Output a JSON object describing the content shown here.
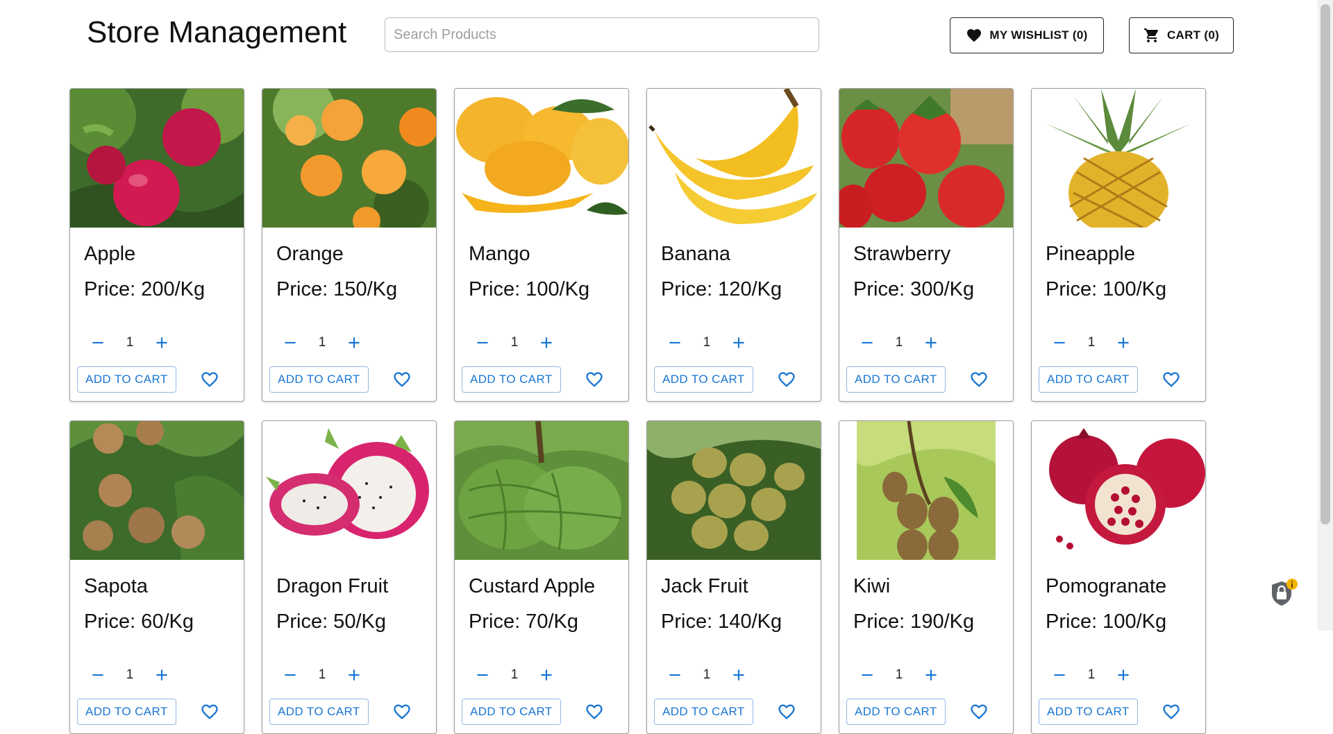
{
  "header": {
    "title": "Store Management",
    "search_placeholder": "Search Products",
    "wishlist_label": "MY WISHLIST (0)",
    "cart_label": "CART (0)"
  },
  "colors": {
    "accent": "#1976d2",
    "border": "#9e9e9e",
    "text": "#111111"
  },
  "product_actions": {
    "add_to_cart_label": "ADD TO CART",
    "quantity_default": "1"
  },
  "products": [
    {
      "name": "Apple",
      "price": "Price: 200/Kg",
      "quantity": "1",
      "image": "apple-image"
    },
    {
      "name": "Orange",
      "price": "Price: 150/Kg",
      "quantity": "1",
      "image": "orange-image"
    },
    {
      "name": "Mango",
      "price": "Price: 100/Kg",
      "quantity": "1",
      "image": "mango-image"
    },
    {
      "name": "Banana",
      "price": "Price: 120/Kg",
      "quantity": "1",
      "image": "banana-image"
    },
    {
      "name": "Strawberry",
      "price": "Price: 300/Kg",
      "quantity": "1",
      "image": "strawberry-image"
    },
    {
      "name": "Pineapple",
      "price": "Price: 100/Kg",
      "quantity": "1",
      "image": "pineapple-image"
    },
    {
      "name": "Sapota",
      "price": "Price: 60/Kg",
      "quantity": "1",
      "image": "sapota-image"
    },
    {
      "name": "Dragon Fruit",
      "price": "Price: 50/Kg",
      "quantity": "1",
      "image": "dragon-fruit-image"
    },
    {
      "name": "Custard Apple",
      "price": "Price: 70/Kg",
      "quantity": "1",
      "image": "custard-apple-image"
    },
    {
      "name": "Jack Fruit",
      "price": "Price: 140/Kg",
      "quantity": "1",
      "image": "jack-fruit-image"
    },
    {
      "name": "Kiwi",
      "price": "Price: 190/Kg",
      "quantity": "1",
      "image": "kiwi-image"
    },
    {
      "name": "Pomogranate",
      "price": "Price: 100/Kg",
      "quantity": "1",
      "image": "pomogranate-image"
    }
  ],
  "icons": {
    "wishlist": "heart-filled-icon",
    "cart": "shopping-cart-icon",
    "decrement": "minus-icon",
    "increment": "plus-icon",
    "favorite": "heart-outline-icon",
    "security": "lock-shield-icon"
  }
}
